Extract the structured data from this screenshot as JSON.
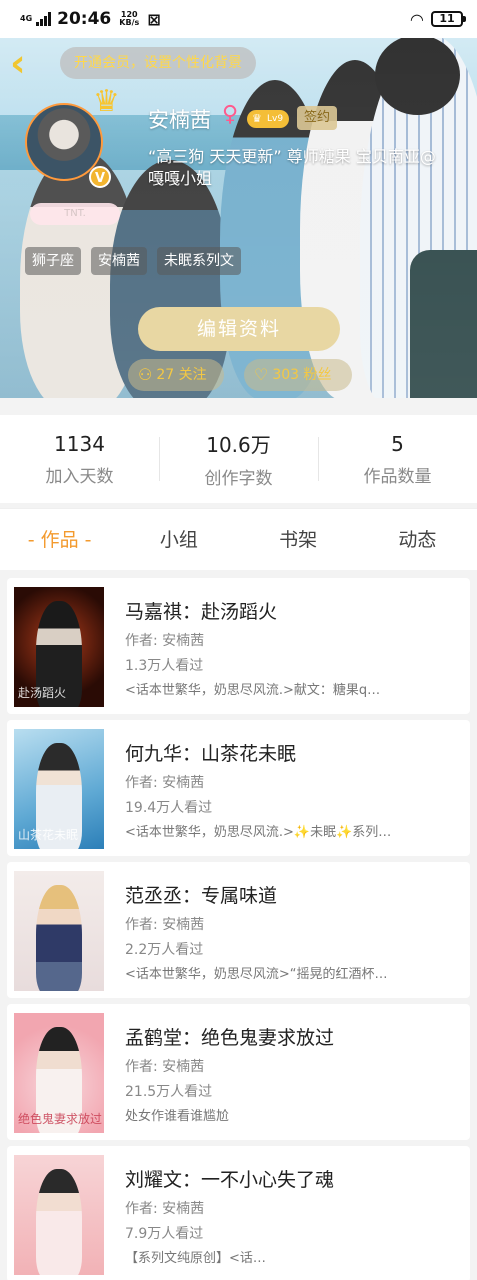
{
  "status_bar": {
    "network": "4G",
    "time": "20:46",
    "speed_value": "120",
    "speed_unit": "KB/s",
    "battery": "11"
  },
  "header": {
    "back_icon": "chevron-left-icon",
    "vip_banner": "开通会员，设置个性化背景"
  },
  "profile": {
    "name": "安楠茜",
    "gender_symbol": "♀",
    "level": "Lv9",
    "signed_label": "签约",
    "bio": "“高三狗 天天更新” 尊师糖果 宝贝南亚@嘎嘎小姐",
    "badge_text": "TNT.",
    "verified_mark": "V",
    "tags": [
      "狮子座",
      "安楠茜",
      "未眠系列文"
    ],
    "edit_button": "编辑资料",
    "follow_count": "27 关注",
    "fans_count": "303 粉丝",
    "colors": {
      "accent": "#f39a2d",
      "gold": "#f4c843"
    }
  },
  "stats": [
    {
      "value": "1134",
      "label": "加入天数"
    },
    {
      "value": "10.6万",
      "label": "创作字数"
    },
    {
      "value": "5",
      "label": "作品数量"
    }
  ],
  "tabs": [
    {
      "label": "- 作品 -",
      "active": true
    },
    {
      "label": "小组",
      "active": false
    },
    {
      "label": "书架",
      "active": false
    },
    {
      "label": "动态",
      "active": false
    }
  ],
  "works": [
    {
      "title": "马嘉祺：赴汤蹈火",
      "author": "作者: 安楠茜",
      "views": "1.3万人看过",
      "desc": "<话本世繁华，奶思尽风流.>献文：糖果q…",
      "cover_text": "赴汤蹈火"
    },
    {
      "title": "何九华：山茶花未眠",
      "author": "作者: 安楠茜",
      "views": "19.4万人看过",
      "desc": "<话本世繁华，奶思尽风流.>✨未眠✨系列…",
      "cover_text": "山茶花未眠"
    },
    {
      "title": "范丞丞：专属味道",
      "author": "作者: 安楠茜",
      "views": "2.2万人看过",
      "desc": "<话本世繁华，奶思尽风流>“摇晃的红酒杯…",
      "cover_text": ""
    },
    {
      "title": "孟鹤堂：绝色鬼妻求放过",
      "author": "作者: 安楠茜",
      "views": "21.5万人看过",
      "desc": "处女作谁看谁尴尬",
      "cover_text": "绝色鬼妻求放过"
    },
    {
      "title": "刘耀文：一不小心失了魂",
      "author": "作者: 安楠茜",
      "views": "7.9万人看过",
      "desc": "【系列文纯原创】<话…",
      "cover_text": ""
    }
  ]
}
